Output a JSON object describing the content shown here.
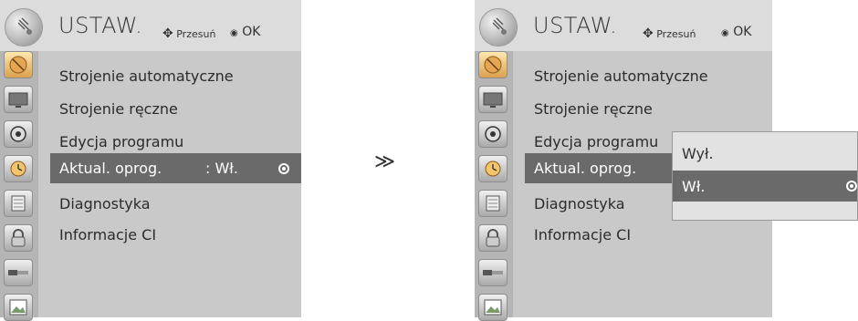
{
  "colors": {
    "panel": "#c9c9c9",
    "header": "#dcdcdc",
    "icon_column": "#b5b5b5",
    "highlight": "#6a6a6a",
    "popup": "#e2e2e2"
  },
  "left": {
    "header": {
      "title": "USTAW.",
      "move_hint": "Przesuń",
      "ok_hint": "OK"
    },
    "menu": [
      {
        "label": "Strojenie automatyczne"
      },
      {
        "label": "Strojenie ręczne"
      },
      {
        "label": "Edycja programu"
      },
      {
        "label": "Aktual. oprog.",
        "value": ": Wł."
      },
      {
        "label": "Diagnostyka"
      },
      {
        "label": "Informacje CI"
      }
    ],
    "selected_index": 3
  },
  "arrow": "≫",
  "right": {
    "header": {
      "title": "USTAW.",
      "move_hint": "Przesuń",
      "ok_hint": "OK"
    },
    "menu": [
      {
        "label": "Strojenie automatyczne"
      },
      {
        "label": "Strojenie ręczne"
      },
      {
        "label": "Edycja programu"
      },
      {
        "label": "Aktual. oprog."
      },
      {
        "label": "Diagnostyka"
      },
      {
        "label": "Informacje CI"
      }
    ],
    "popup": {
      "options": [
        "Wył.",
        "Wł."
      ],
      "selected": "Wł."
    }
  },
  "icons": [
    "satellite-icon",
    "tv-icon",
    "speaker-icon",
    "clock-icon",
    "lock-icon",
    "padlock-icon",
    "connector-icon",
    "image-icon"
  ]
}
